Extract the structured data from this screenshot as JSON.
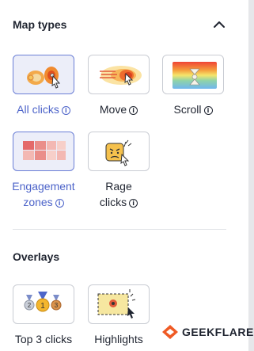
{
  "map_types": {
    "title": "Map types",
    "items": [
      {
        "line1": "All clicks",
        "line2": ""
      },
      {
        "line1": "Move",
        "line2": ""
      },
      {
        "line1": "Scroll",
        "line2": ""
      },
      {
        "line1": "Engagement",
        "line2": "zones"
      },
      {
        "line1": "Rage",
        "line2": "clicks"
      }
    ]
  },
  "overlays": {
    "title": "Overlays",
    "items": [
      {
        "line1": "Top 3 clicks"
      },
      {
        "line1": "Highlights"
      }
    ]
  },
  "medals": [
    "2",
    "1",
    "3"
  ],
  "brand": {
    "name": "GEEKFLARE"
  },
  "colors": {
    "accent": "#4c63c9",
    "selected_bg": "#eceef9",
    "brand": "#ef5a24"
  }
}
